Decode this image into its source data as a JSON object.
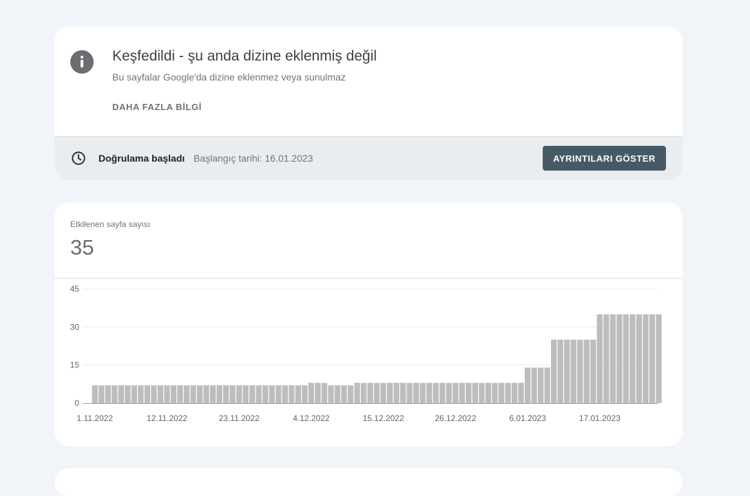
{
  "status_card": {
    "title": "Keşfedildi - şu anda dizine eklenmiş değil",
    "subtitle": "Bu sayfalar Google'da dizine eklenmez veya sunulmaz",
    "learn_more": "DAHA FAZLA BİLGİ",
    "icon": "info-icon",
    "validation": {
      "icon": "clock-icon",
      "label": "Doğrulama başladı",
      "start_date": "Başlangıç tarihi: 16.01.2023",
      "button_label": "AYRINTILARI GÖSTER"
    }
  },
  "metric": {
    "label": "Etkilenen sayfa sayısı",
    "value": "35"
  },
  "colors": {
    "background": "#f1f4f9",
    "card": "#ffffff",
    "validation_bar": "#eaedf0",
    "button": "#455a64",
    "bar": "#bdbdbd",
    "icon": "#6a6d71"
  },
  "chart_data": {
    "type": "bar",
    "title": "",
    "xlabel": "",
    "ylabel": "",
    "ylim": [
      0,
      45
    ],
    "yticks": [
      0,
      15,
      30,
      45
    ],
    "grid": true,
    "x_tick_labels": [
      "1.11.2022",
      "12.11.2022",
      "23.11.2022",
      "4.12.2022",
      "15.12.2022",
      "26.12.2022",
      "6.01.2023",
      "17.01.2023"
    ],
    "x_tick_indices": [
      0,
      11,
      22,
      33,
      44,
      55,
      66,
      77
    ],
    "start_label": "1.11.2022",
    "values": [
      7,
      7,
      7,
      7,
      7,
      7,
      7,
      7,
      7,
      7,
      7,
      7,
      7,
      7,
      7,
      7,
      7,
      7,
      7,
      7,
      7,
      7,
      7,
      7,
      7,
      7,
      7,
      7,
      7,
      7,
      7,
      7,
      7,
      8,
      8,
      8,
      7,
      7,
      7,
      7,
      8,
      8,
      8,
      8,
      8,
      8,
      8,
      8,
      8,
      8,
      8,
      8,
      8,
      8,
      8,
      8,
      8,
      8,
      8,
      8,
      8,
      8,
      8,
      8,
      8,
      8,
      14,
      14,
      14,
      14,
      25,
      25,
      25,
      25,
      25,
      25,
      25,
      35,
      35,
      35,
      35,
      35,
      35,
      35,
      35,
      35,
      35
    ]
  }
}
